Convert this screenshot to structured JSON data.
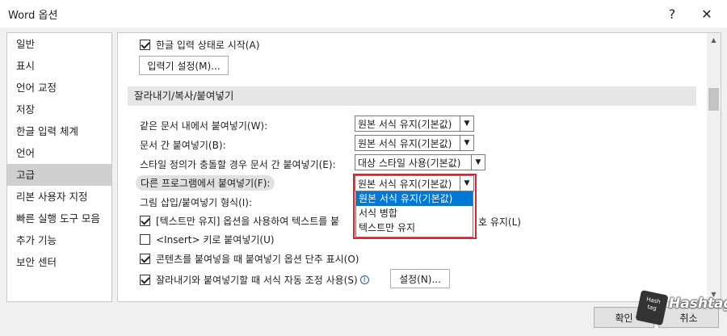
{
  "window": {
    "title": "Word 옵션",
    "help_icon": "?",
    "close_icon": "✕"
  },
  "sidebar": {
    "items": [
      {
        "label": "일반"
      },
      {
        "label": "표시"
      },
      {
        "label": "언어 교정"
      },
      {
        "label": "저장"
      },
      {
        "label": "한글 입력 체계"
      },
      {
        "label": "언어"
      },
      {
        "label": "고급",
        "selected": true
      },
      {
        "label": "리본 사용자 지정"
      },
      {
        "label": "빠른 실행 도구 모음"
      },
      {
        "label": "추가 기능"
      },
      {
        "label": "보안 센터"
      }
    ]
  },
  "main": {
    "korean_input_start": {
      "label": "한글 입력 상태로 시작(A)",
      "checked": true
    },
    "ime_settings_button": "입력기 설정(M)...",
    "section_title": "잘라내기/복사/붙여넣기",
    "paste_options": [
      {
        "label": "같은 문서 내에서 붙여넣기(W):",
        "value": "원본 서식 유지(기본값)"
      },
      {
        "label": "문서 간 붙여넣기(B):",
        "value": "원본 서식 유지(기본값)"
      },
      {
        "label": "스타일 정의가 충돌할 경우 문서 간 붙여넣기(E):",
        "value": "대상 스타일 사용(기본값)"
      },
      {
        "label": "다른 프로그램에서 붙여넣기(F):",
        "value": "원본 서식 유지(기본값)"
      }
    ],
    "dropdown_options": [
      "원본 서식 유지(기본값)",
      "서식 병합",
      "텍스트만 유지"
    ],
    "dropdown_selected_index": 0,
    "insert_paste_label": "그림 삽입/붙여넣기 형식(I):",
    "text_only_bullets": {
      "label_start": "[텍스트만 유지] 옵션을 사용하여 텍스트를 붙",
      "label_end": "호 유지(L)",
      "checked": true
    },
    "insert_key_paste": {
      "label": "<Insert> 키로 붙여넣기(U)",
      "checked": false
    },
    "show_paste_options": {
      "label": "콘텐츠를 붙여넣을 때 붙여넣기 옵션 단추 표시(O)",
      "checked": true
    },
    "smart_cut_paste": {
      "label": "잘라내기와 붙여넣기할 때 서식 자동 조정 사용(S)",
      "checked": true
    },
    "settings_button": "설정(N)..."
  },
  "footer": {
    "ok_label": "확인",
    "cancel_label": "취소"
  },
  "watermark": {
    "text": "Hashtag",
    "badge": "Hash tag"
  },
  "colors": {
    "accent": "#0078d7",
    "highlight_box": "#e3212b"
  }
}
